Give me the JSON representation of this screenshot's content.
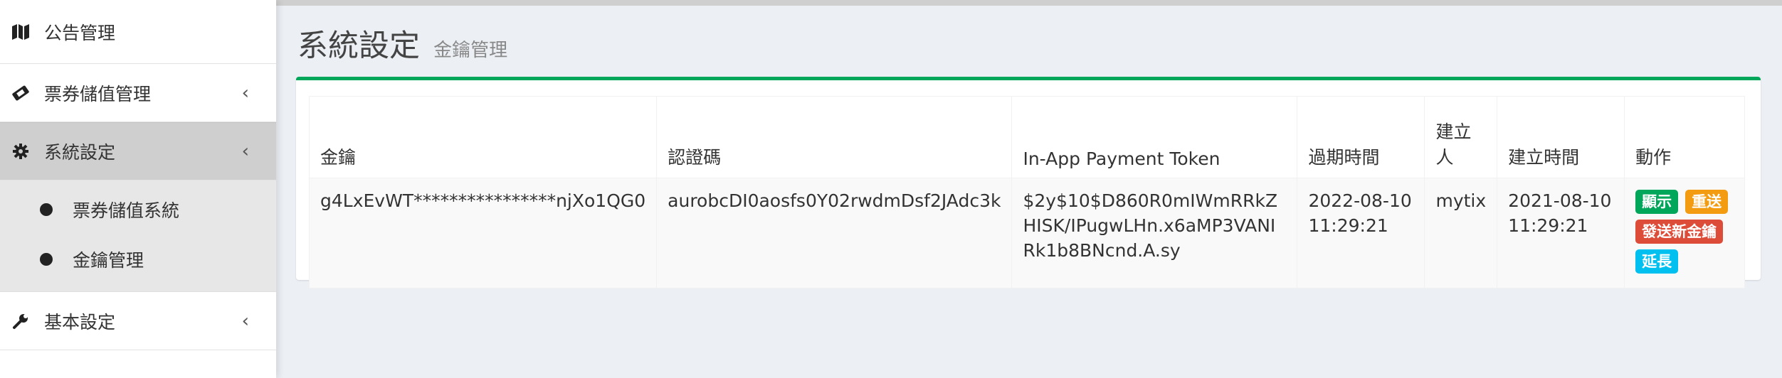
{
  "sidebar": {
    "items": [
      {
        "label": "公告管理",
        "icon": "map-icon"
      },
      {
        "label": "票券儲值管理",
        "icon": "ticket-icon"
      },
      {
        "label": "系統設定",
        "icon": "gear-icon"
      },
      {
        "label": "基本設定",
        "icon": "wrench-icon"
      }
    ],
    "chevron": "‹",
    "submenu": [
      {
        "label": "票券儲值系統"
      },
      {
        "label": "金鑰管理"
      }
    ]
  },
  "header": {
    "title": "系統設定",
    "subtitle": "金鑰管理"
  },
  "table": {
    "columns": [
      "金鑰",
      "認證碼",
      "In-App Payment Token",
      "過期時間",
      "建立人",
      "建立時間",
      "動作"
    ],
    "rows": [
      {
        "key": "g4LxEvWT****************njXo1QG0",
        "auth_code": "aurobcDI0aosfs0Y02rwdmDsf2JAdc3k",
        "token": "$2y$10$D860R0mIWmRRkZHISK/IPugwLHn.x6aMP3VANIRk1b8BNcnd.A.sy",
        "expire": "2022-08-10 11:29:21",
        "creator": "mytix",
        "created": "2021-08-10 11:29:21",
        "actions": {
          "show": "顯示",
          "reset": "重送",
          "send_new": "發送新金鑰",
          "extend": "延長"
        }
      }
    ]
  },
  "colors": {
    "box_border": "#00a65a",
    "btn_show": "#00a65a",
    "btn_reset": "#f39c12",
    "btn_send_new": "#dd4b39",
    "btn_extend": "#00c0ef"
  }
}
